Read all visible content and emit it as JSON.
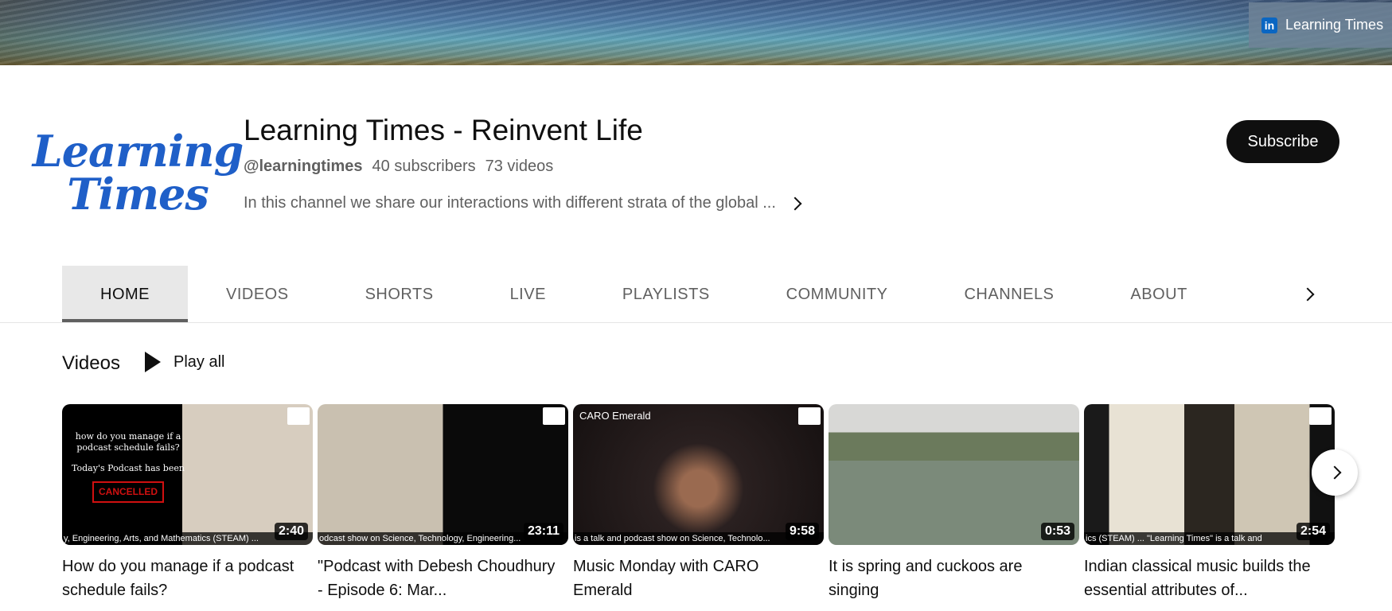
{
  "banner": {
    "link_label": "Learning Times",
    "link_icon": "linkedin-icon"
  },
  "channel": {
    "avatar_line1": "Learning",
    "avatar_line2": "Times",
    "title": "Learning Times - Reinvent Life",
    "handle": "@learningtimes",
    "subscribers": "40 subscribers",
    "video_count": "73 videos",
    "description": "In this channel we share our interactions with different strata of the global ...",
    "subscribe_label": "Subscribe"
  },
  "tabs": [
    {
      "label": "HOME",
      "active": true
    },
    {
      "label": "VIDEOS"
    },
    {
      "label": "SHORTS"
    },
    {
      "label": "LIVE"
    },
    {
      "label": "PLAYLISTS"
    },
    {
      "label": "COMMUNITY"
    },
    {
      "label": "CHANNELS"
    },
    {
      "label": "ABOUT"
    }
  ],
  "section": {
    "title": "Videos",
    "play_all_label": "Play all"
  },
  "videos": [
    {
      "title": "How do you manage if a podcast schedule fails?",
      "duration": "2:40",
      "thumb_text": "how do you manage if a podcast schedule fails?",
      "thumb_sub": "Today's Podcast has been",
      "thumb_badge": "CANCELLED",
      "ticker": "y, Engineering, Arts, and Mathematics (STEAM) ..."
    },
    {
      "title": "\"Podcast with Debesh Choudhury - Episode 6: Mar...",
      "duration": "23:11",
      "thumb_label": "",
      "ticker": "odcast show on Science, Technology, Engineering..."
    },
    {
      "title": "Music Monday with CARO Emerald",
      "duration": "9:58",
      "thumb_label": "CARO Emerald",
      "ticker": "is a talk and podcast show on Science, Technolo..."
    },
    {
      "title": "It is spring and cuckoos are singing",
      "duration": "0:53",
      "ticker": ""
    },
    {
      "title": "Indian classical music builds the essential attributes of...",
      "duration": "2:54",
      "ticker": "ics (STEAM) ...     \"Learning Times\" is a talk and"
    }
  ],
  "colors": {
    "subscribe_bg": "#0f0f0f",
    "avatar_blue": "#1f5fc8",
    "linkedin_blue": "#0a66c2"
  }
}
